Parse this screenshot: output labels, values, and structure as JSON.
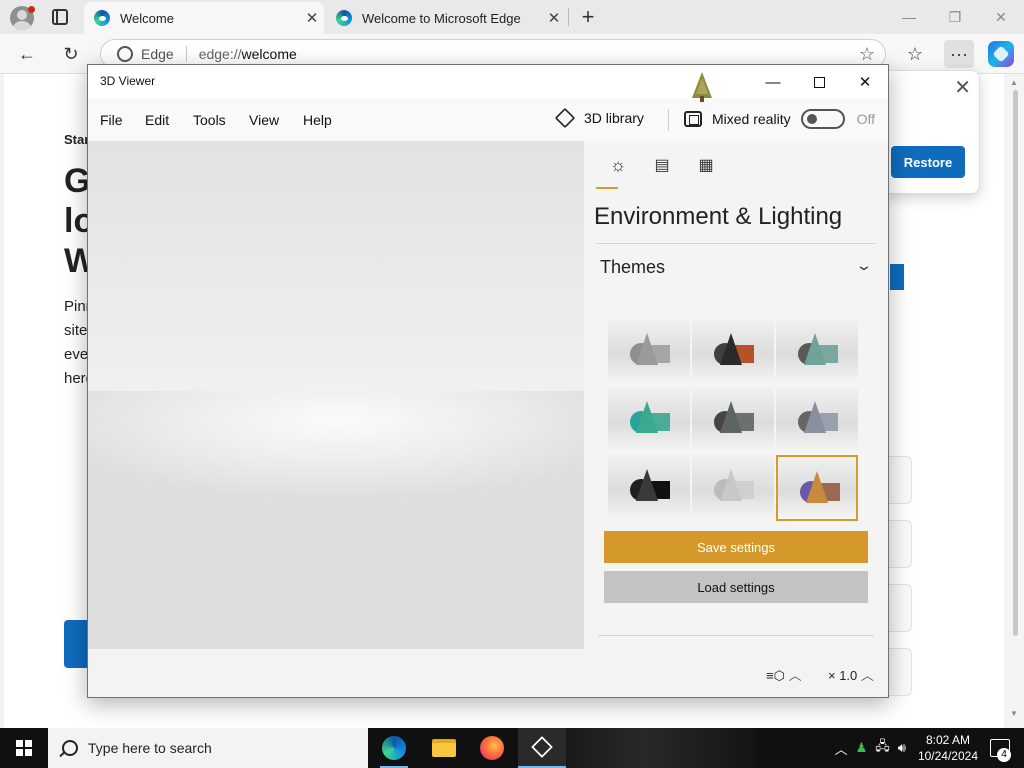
{
  "browser": {
    "tabs": [
      {
        "title": "Welcome",
        "active": true
      },
      {
        "title": "Welcome to Microsoft Edge",
        "active": false
      }
    ],
    "address": {
      "site_label": "Edge",
      "scheme": "edge://",
      "host": "welcome"
    },
    "page": {
      "kicker": "Star",
      "heading_lines": [
        "Ge",
        "lo",
        "W"
      ],
      "paragraph_lines": [
        "Pinn",
        "sites",
        "ever",
        "here"
      ]
    },
    "popup": {
      "restore_label": "Restore"
    }
  },
  "viewer": {
    "title": "3D Viewer",
    "menu": [
      "File",
      "Edit",
      "Tools",
      "View",
      "Help"
    ],
    "library_label": "3D library",
    "mixed_reality_label": "Mixed reality",
    "mixed_reality_state": "Off",
    "panel": {
      "tabs": [
        {
          "name": "environment-lighting",
          "icon": "sun-icon",
          "active": true
        },
        {
          "name": "stats-shading",
          "icon": "chart-icon",
          "active": false
        },
        {
          "name": "grid-views",
          "icon": "grid-icon",
          "active": false
        }
      ],
      "heading": "Environment & Lighting",
      "themes_label": "Themes",
      "themes": [
        {
          "ball": "#8e8e8e",
          "cone": "#9a9a9a",
          "box": "#a5a5a5",
          "selected": false
        },
        {
          "ball": "#3f3f3f",
          "cone": "#2a2a2a",
          "box": "#b4522a",
          "selected": false
        },
        {
          "ball": "#5a5a5a",
          "cone": "#6fa39a",
          "box": "#7aa79f",
          "selected": false
        },
        {
          "ball": "#2aa39a",
          "cone": "#3aaa8e",
          "box": "#49ad98",
          "selected": false
        },
        {
          "ball": "#454545",
          "cone": "#5c6562",
          "box": "#6c706e",
          "selected": false
        },
        {
          "ball": "#666666",
          "cone": "#8a8fa0",
          "box": "#9aa0ad",
          "selected": false
        },
        {
          "ball": "#202020",
          "cone": "#3a3a3a",
          "box": "#111111",
          "selected": false
        },
        {
          "ball": "#bcbcbc",
          "cone": "#c8c8c8",
          "box": "#cfcfcf",
          "selected": false
        },
        {
          "ball": "#6a58a8",
          "cone": "#c88a3c",
          "box": "#9a6a52",
          "selected": true
        }
      ],
      "save_label": "Save settings",
      "load_label": "Load settings"
    },
    "status": {
      "speed": "× 1.0"
    }
  },
  "taskbar": {
    "search_placeholder": "Type here to search",
    "time": "8:02 AM",
    "date": "10/24/2024",
    "notification_count": "4"
  },
  "colors": {
    "accent": "#d4982b",
    "edge_blue": "#0f6cbd"
  }
}
